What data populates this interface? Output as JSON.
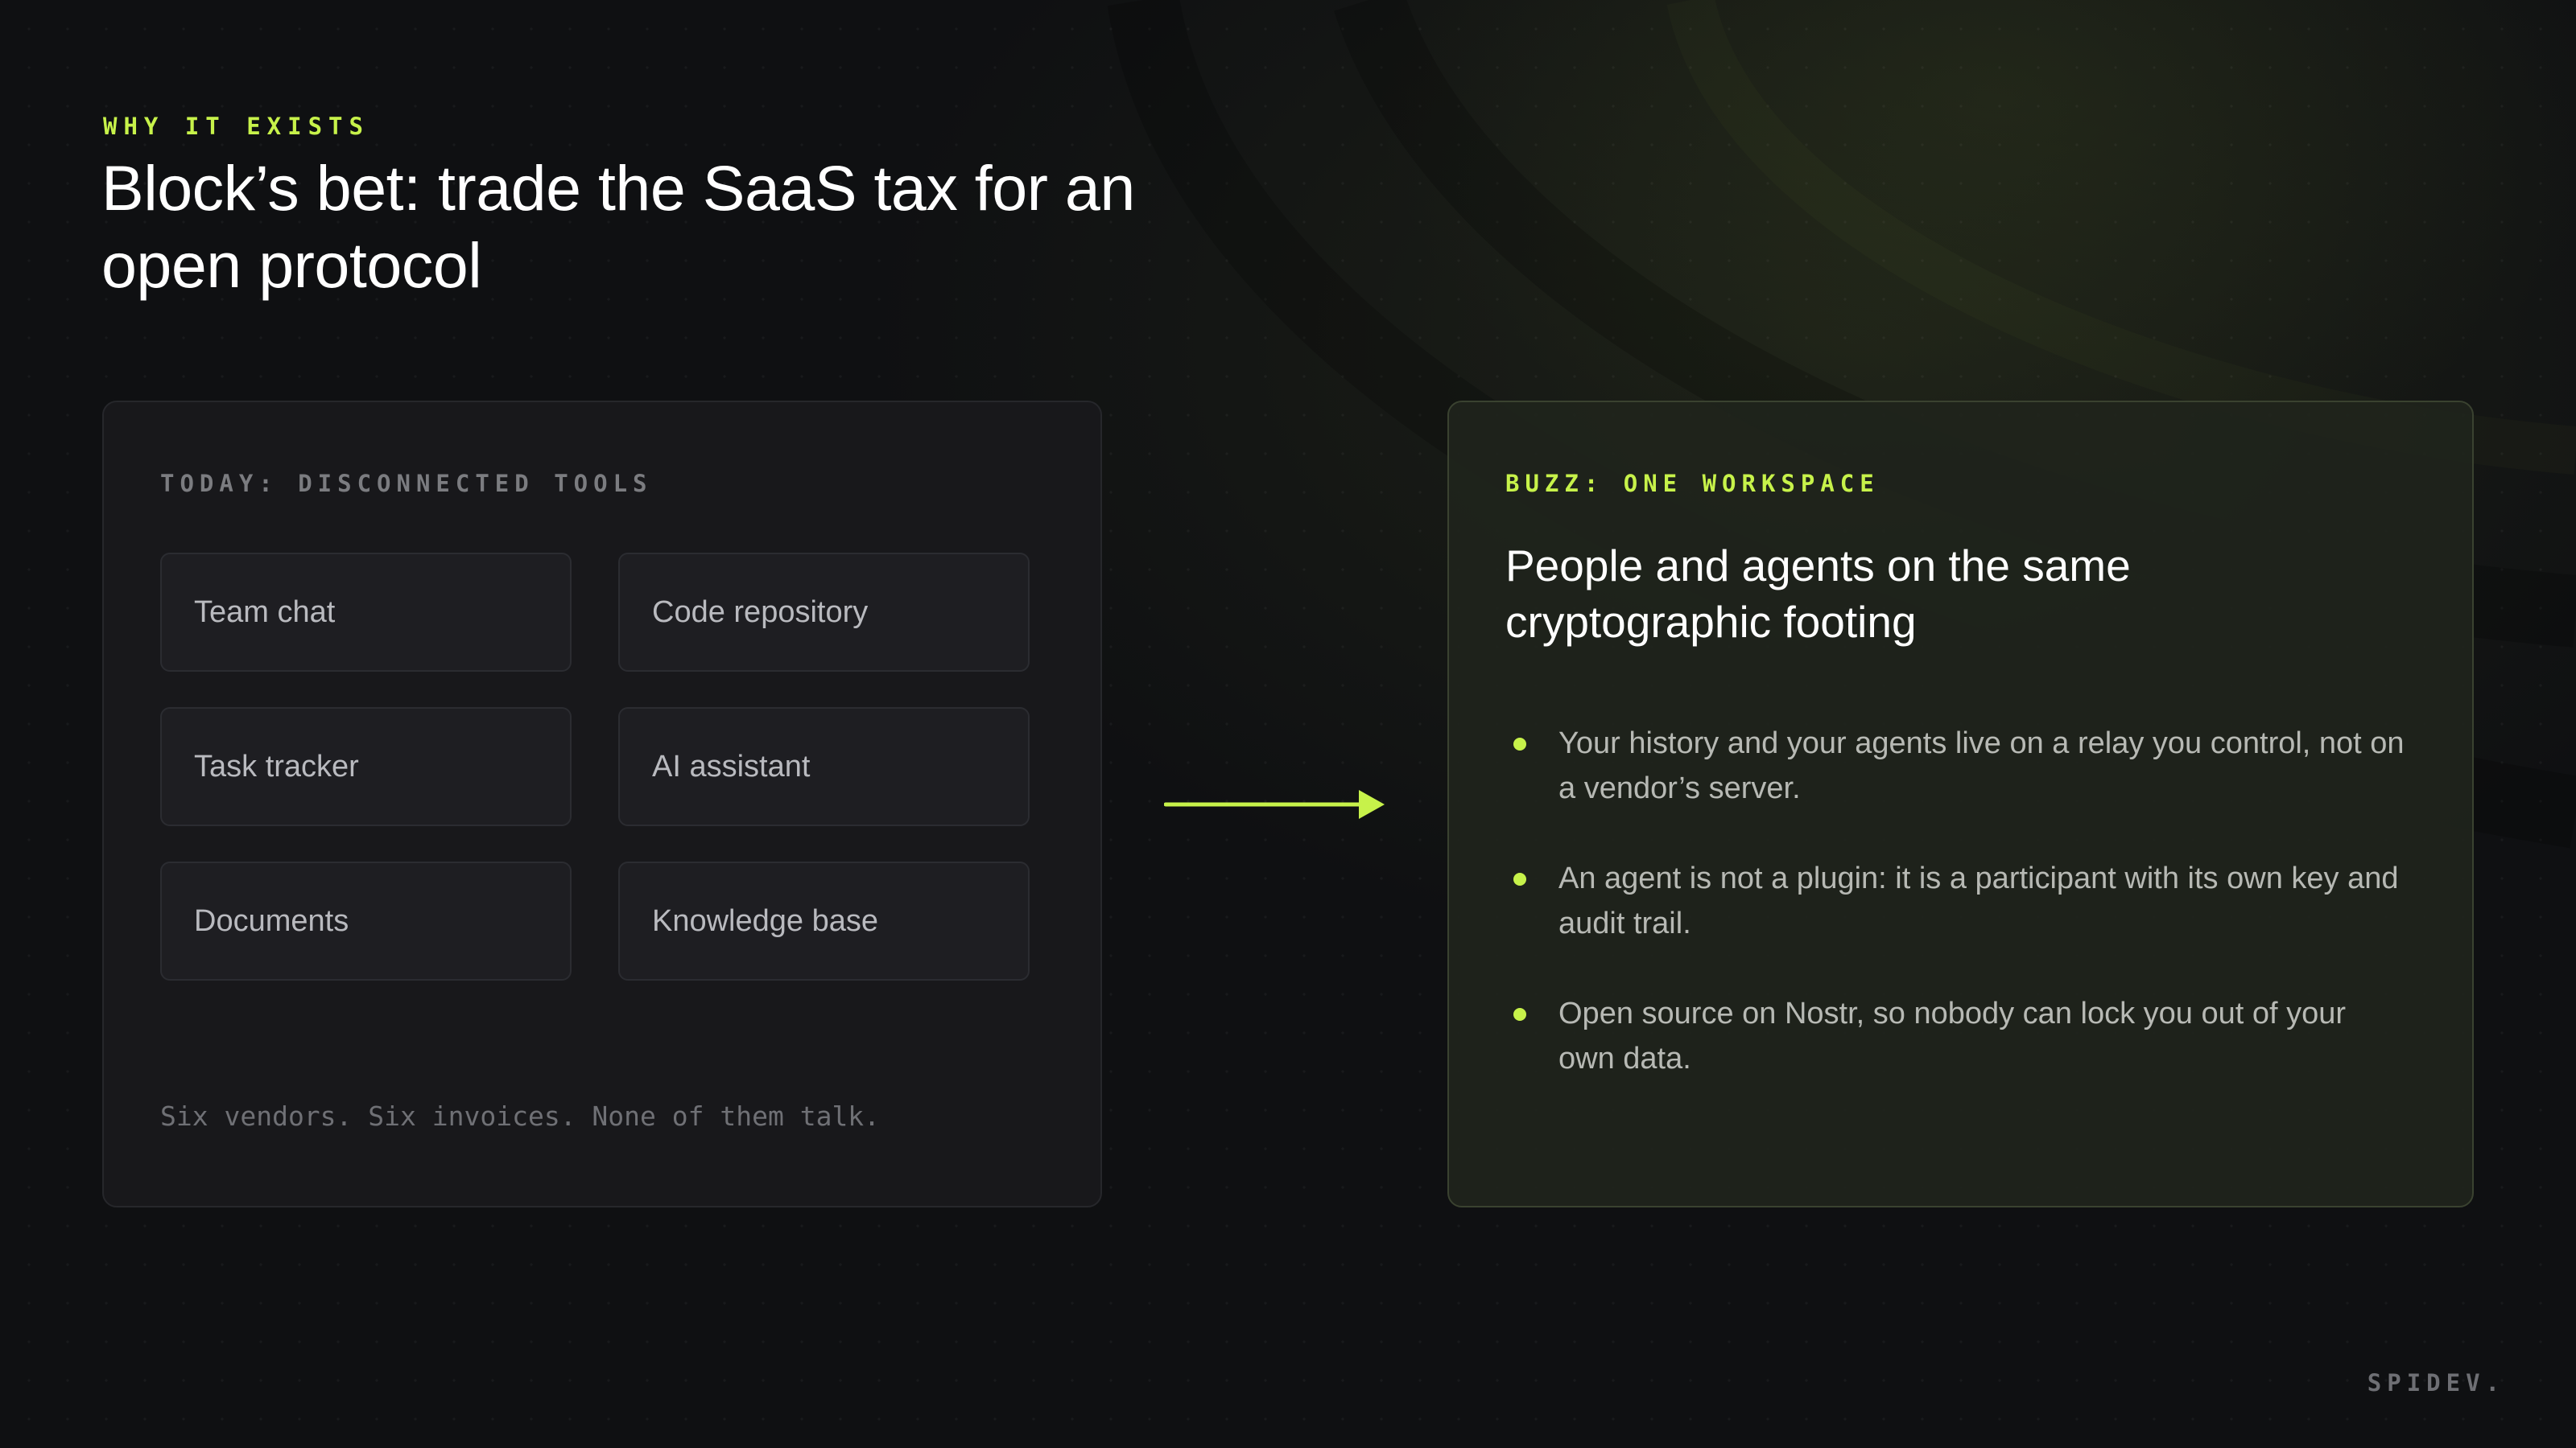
{
  "slide": {
    "kicker": "WHY IT EXISTS",
    "headline": "Block’s bet: trade the SaaS tax for an open protocol"
  },
  "today_card": {
    "label": "TODAY: DISCONNECTED TOOLS",
    "tools": [
      "Team chat",
      "Code repository",
      "Task tracker",
      "AI assistant",
      "Documents",
      "Knowledge base"
    ],
    "footnote": "Six vendors. Six invoices. None of them talk."
  },
  "transition_arrow": {
    "icon": "arrow-right-icon",
    "color": "#c7f24a"
  },
  "buzz_card": {
    "label": "BUZZ: ONE WORKSPACE",
    "title": "People and agents on the same cryptographic footing",
    "bullets": [
      "Your history and your agents live on a relay you control, not on a vendor’s server.",
      "An agent is not a plugin: it is a participant with its own key and audit trail.",
      "Open source on Nostr, so nobody can lock you out of your own data."
    ]
  },
  "brand": "SPIDEV.",
  "colors": {
    "accent": "#c7f24a",
    "background": "#0f1012",
    "card_left": "#18181b",
    "card_right": "#20241c"
  }
}
